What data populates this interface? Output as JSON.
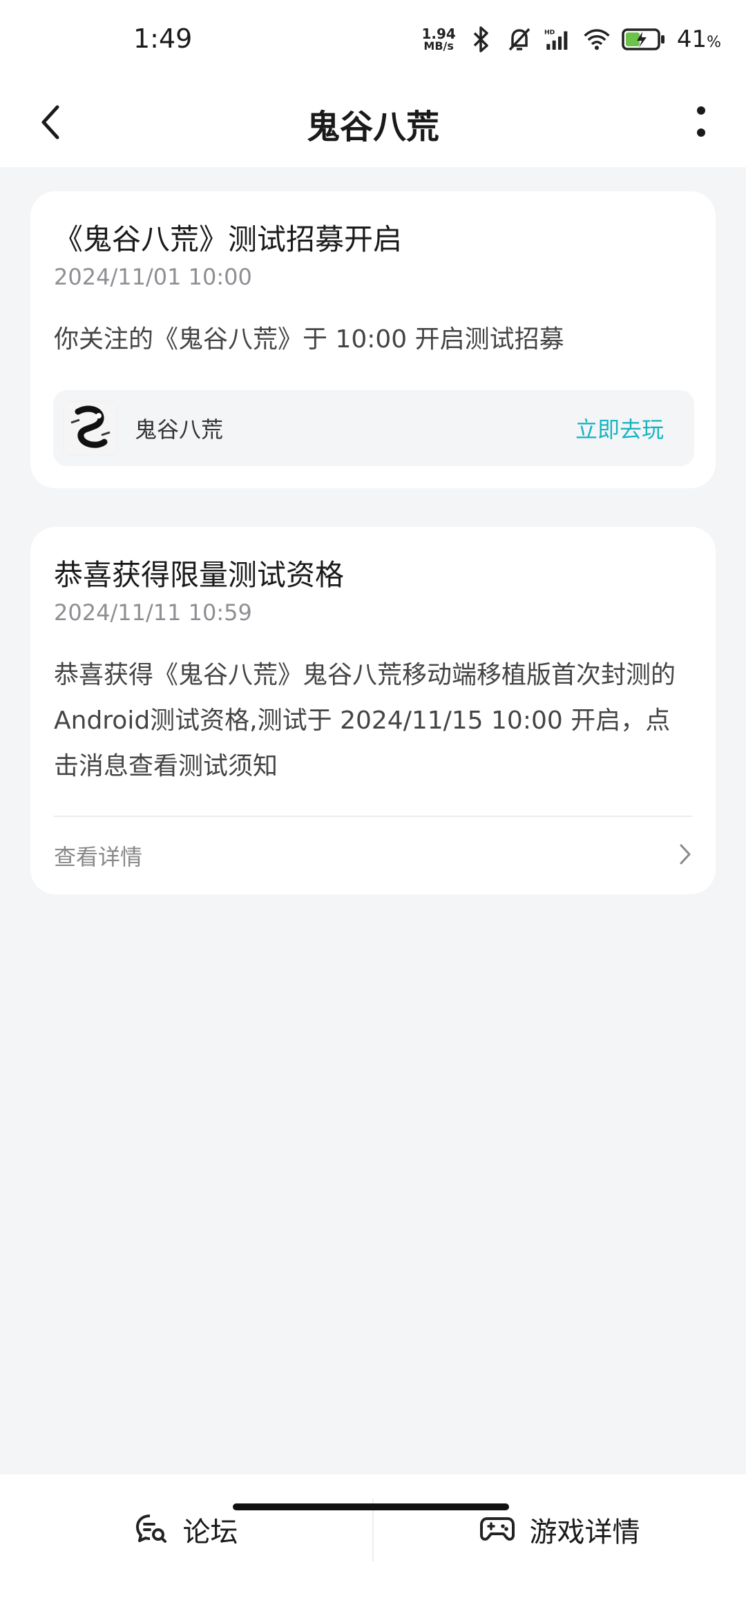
{
  "status_bar": {
    "time": "1:49",
    "net_speed_value": "1.94",
    "net_speed_unit": "MB/s",
    "battery_percent": "41",
    "battery_symbol": "%",
    "icons": [
      "bluetooth-icon",
      "mute-bell-icon",
      "hd-signal-icon",
      "wifi-icon",
      "battery-charging-icon"
    ]
  },
  "header": {
    "title": "鬼谷八荒",
    "back_icon": "chevron-left-icon",
    "more_icon": "vertical-dots-icon"
  },
  "messages": [
    {
      "title": "《鬼谷八荒》测试招募开启",
      "time": "2024/11/01 10:00",
      "body": "你关注的《鬼谷八荒》于 10:00 开启测试招募",
      "game": {
        "name": "鬼谷八荒",
        "action": "立即去玩"
      }
    },
    {
      "title": "恭喜获得限量测试资格",
      "time": "2024/11/11 10:59",
      "body": "恭喜获得《鬼谷八荒》鬼谷八荒移动端移植版首次封测的Android测试资格,测试于 2024/11/15 10:00 开启，点击消息查看测试须知",
      "detail_label": "查看详情"
    }
  ],
  "bottom_bar": {
    "forum_label": "论坛",
    "game_detail_label": "游戏详情"
  },
  "colors": {
    "accent": "#18b4c0",
    "background": "#f4f5f7",
    "card": "#ffffff"
  }
}
